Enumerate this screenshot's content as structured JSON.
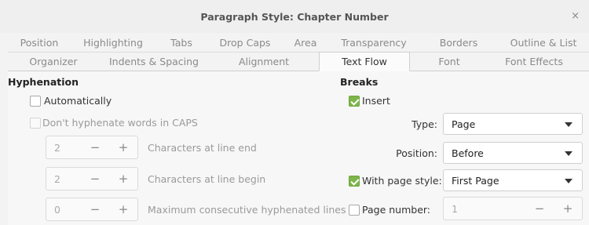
{
  "window": {
    "title": "Paragraph Style: Chapter Number",
    "close_glyph": "×"
  },
  "tabs_row1": [
    "Position",
    "Highlighting",
    "Tabs",
    "Drop Caps",
    "Area",
    "Transparency",
    "Borders",
    "Outline & List"
  ],
  "tabs_row2": [
    "Organizer",
    "Indents & Spacing",
    "Alignment",
    "Text Flow",
    "Font",
    "Font Effects"
  ],
  "active_tab": "Text Flow",
  "hyphenation": {
    "heading": "Hyphenation",
    "automatically": {
      "label": "Automatically",
      "checked": false
    },
    "caps": {
      "label": "Don't hyphenate words in CAPS",
      "checked": false
    },
    "line_end": {
      "value": "2",
      "label": "Characters at line end"
    },
    "line_begin": {
      "value": "2",
      "label": "Characters at line begin"
    },
    "max_consecutive": {
      "value": "0",
      "label": "Maximum consecutive hyphenated lines"
    },
    "minus": "−",
    "plus": "+"
  },
  "breaks": {
    "heading": "Breaks",
    "insert": {
      "label": "Insert",
      "checked": true
    },
    "type": {
      "label": "Type:",
      "value": "Page"
    },
    "position": {
      "label": "Position:",
      "value": "Before"
    },
    "with_page_style": {
      "label": "With page style:",
      "checked": true,
      "value": "First Page"
    },
    "page_number": {
      "label": "Page number:",
      "checked": false,
      "value": "1"
    },
    "minus": "−",
    "plus": "+"
  },
  "colors": {
    "accent_check": "#7db64a",
    "background": "#f3f3f3"
  }
}
